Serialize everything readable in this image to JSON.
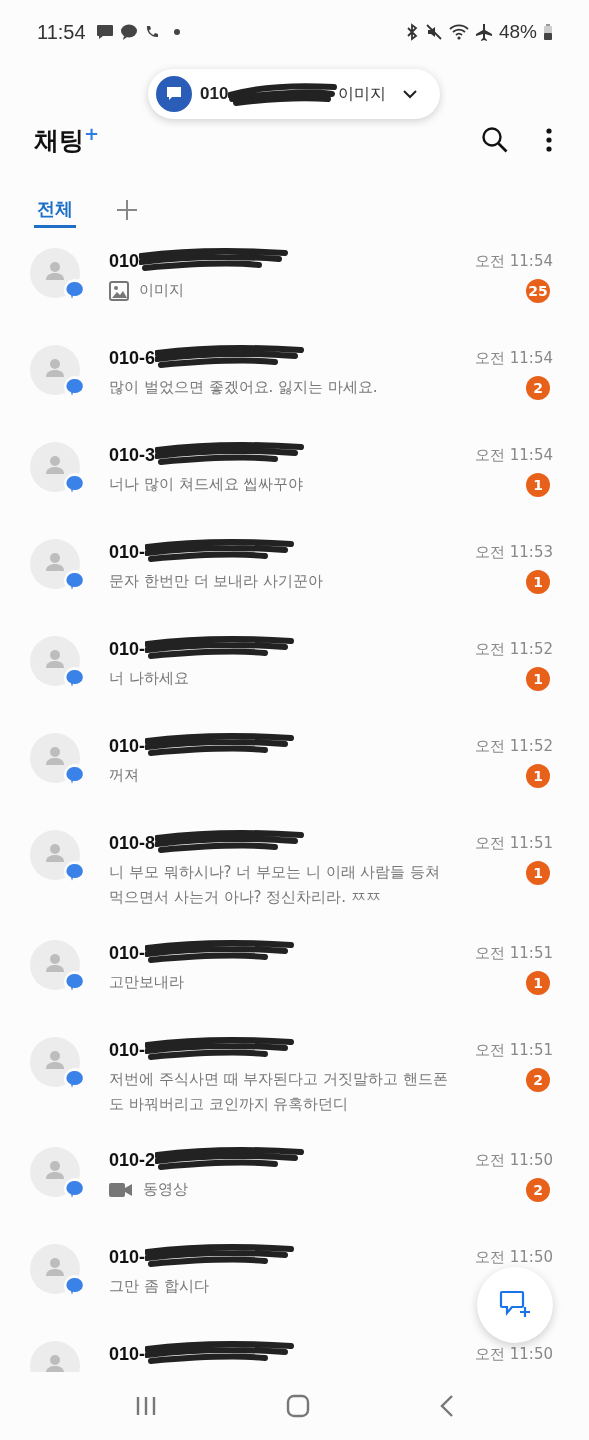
{
  "status_bar": {
    "time": "11:54",
    "battery": "48%"
  },
  "notification": {
    "sender": "010",
    "text": "이미지"
  },
  "header": {
    "title": "채팅$^{+}$"
  },
  "tabs": [
    {
      "label": "전체",
      "selected": true
    }
  ],
  "conversations": [
    {
      "name": "010",
      "kind": "image",
      "preview": "이미지",
      "time": "오전 11:54",
      "unread": "25"
    },
    {
      "name": "010-6",
      "kind": "text",
      "preview": "많이 벌었으면 좋겠어요. 잃지는 마세요.",
      "time": "오전 11:54",
      "unread": "2"
    },
    {
      "name": "010-3",
      "kind": "text",
      "preview": "너나 많이 쳐드세요 씹싸꾸야",
      "time": "오전 11:54",
      "unread": "1"
    },
    {
      "name": "010-",
      "kind": "text",
      "preview": "문자 한번만 더 보내라 사기꾼아",
      "time": "오전 11:53",
      "unread": "1"
    },
    {
      "name": "010-",
      "kind": "text",
      "preview": "너 나하세요",
      "time": "오전 11:52",
      "unread": "1"
    },
    {
      "name": "010-",
      "kind": "text",
      "preview": "꺼져",
      "time": "오전 11:52",
      "unread": "1"
    },
    {
      "name": "010-8",
      "kind": "text",
      "preview": "니 부모 뭐하시나? 너 부모는 니 이래 사람들 등쳐먹으면서 사는거 아나? 정신차리라. ㅉㅉ",
      "time": "오전 11:51",
      "unread": "1"
    },
    {
      "name": "010-",
      "kind": "text",
      "preview": "고만보내라",
      "time": "오전 11:51",
      "unread": "1"
    },
    {
      "name": "010-",
      "kind": "text",
      "preview": "저번에 주식사면 때 부자된다고 거짓말하고 핸드폰도 바꿔버리고 코인까지 유혹하던디",
      "time": "오전 11:51",
      "unread": "2"
    },
    {
      "name": "010-2",
      "kind": "video",
      "preview": "동영상",
      "time": "오전 11:50",
      "unread": "2"
    },
    {
      "name": "010-",
      "kind": "text",
      "preview": "그만 좀 합시다",
      "time": "오전 11:50"
    },
    {
      "name": "010-",
      "time": "오전 11:50"
    }
  ]
}
